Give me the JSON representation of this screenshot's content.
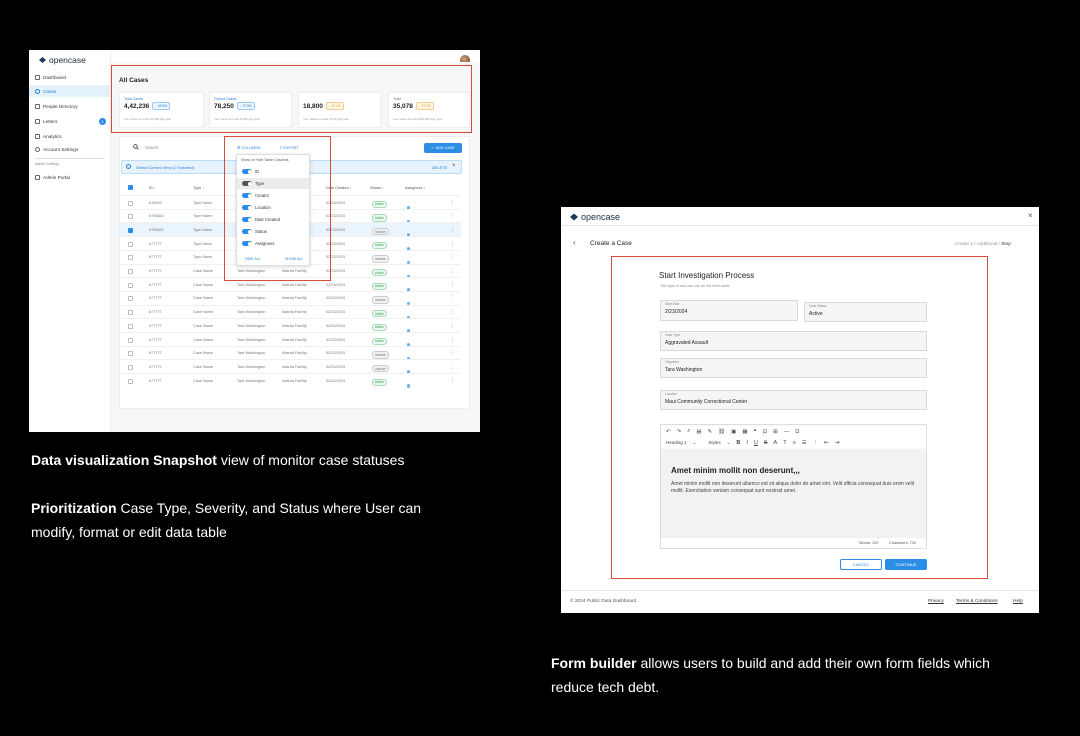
{
  "left_shot": {
    "brand": "opencase",
    "nav": [
      {
        "label": "Dashboard",
        "icon": "dashboard-icon"
      },
      {
        "label": "Cases",
        "icon": "cases-icon"
      },
      {
        "label": "People Directory",
        "icon": "people-icon"
      },
      {
        "label": "Letters",
        "icon": "letters-icon",
        "badge": "1"
      },
      {
        "label": "Analytics",
        "icon": "analytics-icon"
      },
      {
        "label": "Account Settings",
        "icon": "settings-icon"
      }
    ],
    "admin_section_label": "Admin Settings",
    "admin_portal": "Admin Portal",
    "page_title": "All Cases",
    "stats": [
      {
        "label": "Total Cases",
        "value": "4,42,236",
        "chip": "↑ 59.8%",
        "foot": "You made an extra 35,000 this year"
      },
      {
        "label": "Closed Cases",
        "value": "78,250",
        "chip": "↑ 70.5%",
        "foot": "You made an extra 8,900 this year"
      },
      {
        "label": "",
        "value": "18,800",
        "chip": "↓ 27.4%",
        "foot": "You made an extra 18,90 this year"
      },
      {
        "label": "Total",
        "value": "35,078",
        "chip": "↓ 27.4%",
        "foot": "You made an extra $20,395 this year"
      }
    ],
    "search_placeholder": "Search",
    "columns_btn": "COLUMNS",
    "export_btn": "EXPORT",
    "add_case_btn": "ADD CASE",
    "selection_text": "Select Current View (1 Selected)",
    "delete_label": "DELETE",
    "headers": [
      "ID",
      "Type",
      "Date Created",
      "Status",
      "Assignees"
    ],
    "rows": [
      {
        "id": "#19923",
        "type": "Type Name",
        "date": "02/23/2024",
        "status": "Active",
        "sel": false,
        "cr": "",
        "loc": ""
      },
      {
        "id": "#790842",
        "type": "Type Name",
        "date": "02/23/2024",
        "status": "Active",
        "sel": false,
        "cr": "",
        "loc": "ty"
      },
      {
        "id": "#790842",
        "type": "Type Name",
        "date": "02/23/2024",
        "status": "Inactive",
        "sel": true,
        "cr": "",
        "loc": "ty"
      },
      {
        "id": "#77777",
        "type": "Type Name",
        "date": "02/23/2024",
        "status": "Active",
        "sel": false,
        "cr": "",
        "loc": "ty"
      },
      {
        "id": "#77777",
        "type": "Type Name",
        "date": "02/23/2024",
        "status": "Inactive",
        "sel": false,
        "cr": "",
        "loc": "ty"
      },
      {
        "id": "#77777",
        "type": "Case Name",
        "date": "02/23/2024",
        "status": "Active",
        "sel": false,
        "cr": "Tara Washington",
        "loc": "Atlanta Facility"
      },
      {
        "id": "#77777",
        "type": "Case Name",
        "date": "02/23/2024",
        "status": "Active",
        "sel": false,
        "cr": "Tara Washington",
        "loc": "Atlanta Facility"
      },
      {
        "id": "#77777",
        "type": "Case Name",
        "date": "02/23/2024",
        "status": "Inactive",
        "sel": false,
        "cr": "Tara Washington",
        "loc": "Atlanta Facility"
      },
      {
        "id": "#77777",
        "type": "Case Name",
        "date": "02/23/2024",
        "status": "Active",
        "sel": false,
        "cr": "Tara Washington",
        "loc": "Atlanta Facility"
      },
      {
        "id": "#77777",
        "type": "Case Name",
        "date": "02/23/2024",
        "status": "Active",
        "sel": false,
        "cr": "Tara Washington",
        "loc": "Atlanta Facility"
      },
      {
        "id": "#77777",
        "type": "Case Name",
        "date": "02/23/2024",
        "status": "Active",
        "sel": false,
        "cr": "Tara Washington",
        "loc": "Atlanta Facility"
      },
      {
        "id": "#77777",
        "type": "Case Name",
        "date": "02/23/2024",
        "status": "Inactive",
        "sel": false,
        "cr": "Tara Washington",
        "loc": "Atlanta Facility"
      },
      {
        "id": "#77777",
        "type": "Case Name",
        "date": "02/23/2024",
        "status": "Inactive",
        "sel": false,
        "cr": "Tara Washington",
        "loc": "Atlanta Facility"
      },
      {
        "id": "#77777",
        "type": "Case Name",
        "date": "02/23/2024",
        "status": "Active",
        "sel": false,
        "cr": "Tara Washington",
        "loc": "Atlanta Facility"
      }
    ],
    "column_popover": {
      "heading": "Show or Hide Table Columns",
      "items": [
        "ID",
        "Type",
        "Creator",
        "Location",
        "Date Created",
        "Status",
        "Assignees"
      ],
      "hide_all": "HIDE ALL",
      "show_all": "SHOW ALL"
    }
  },
  "captions": {
    "c1_bold": "Data visualization Snapshot",
    "c1_rest": " view of monitor case statuses",
    "c2_bold": "Prioritization",
    "c2_rest": " Case Type, Severity, and Status where User can modify, format or edit data table",
    "c3_bold": "Form builder",
    "c3_rest": " allows users to build and add their own form fields which reduce tech debt."
  },
  "right_shot": {
    "brand": "opencase",
    "page_title": "Create a Case",
    "steps": {
      "s1": "Create 1",
      "s2": "Additional",
      "s3": "Step"
    },
    "form_title": "Start Investigation Process",
    "form_subtitle": "This type of card can use as 3rd level cards",
    "fields": {
      "start_date": {
        "label": "Start Date",
        "value": "2/23/2024"
      },
      "case_status": {
        "label": "Case Status",
        "value": "Active"
      },
      "case_type": {
        "label": "Case Type",
        "value": "Aggravated Assault"
      },
      "originator": {
        "label": "Originator",
        "value": "Tara Washington"
      },
      "location": {
        "label": "Location",
        "value": "Maui Community Correctional Center"
      }
    },
    "editor": {
      "heading_select": "Heading 1",
      "styles_select": "Styles",
      "heading": "Amet minim mollit non deserunt,,,",
      "body": "Amet minim mollit non deserunt ullamco est sit aliqua dolor do amet sint. Velit officia consequat duis enim velit mollit. Exercitation veniam consequat sunt nostrud amet.",
      "words": "Words: 120",
      "characters": "Characters: 730"
    },
    "cancel": "CANCEL",
    "continue": "CONTINUE",
    "copyright": "© 2024 Public Data Dashboard",
    "links": [
      "Privacy",
      "Terms & Conditions",
      "Help"
    ]
  },
  "colors": {
    "accent": "#2b8de6",
    "highlight_border": "#d94a3a",
    "active": "#2e9a4c",
    "warning": "#e59a1c"
  }
}
